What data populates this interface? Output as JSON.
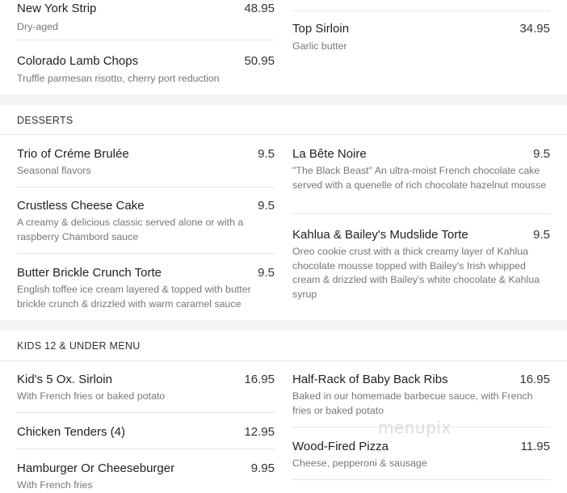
{
  "steaks": {
    "left": [
      {
        "name": "New York Strip",
        "price": "48.95",
        "desc": "Dry-aged"
      },
      {
        "name": "Colorado Lamb Chops",
        "price": "50.95",
        "desc": "Truffle parmesan risotto, cherry port reduction"
      }
    ],
    "right": [
      {
        "name": "Top Sirloin",
        "price": "34.95",
        "desc": "Garlic butter"
      }
    ]
  },
  "desserts": {
    "title": "DESSERTS",
    "left": [
      {
        "name": "Trio of Créme Brulée",
        "price": "9.5",
        "desc": "Seasonal flavors"
      },
      {
        "name": "Crustless Cheese Cake",
        "price": "9.5",
        "desc": "A creamy & delicious classic served alone or with a raspberry Chambord sauce"
      },
      {
        "name": "Butter Brickle Crunch Torte",
        "price": "9.5",
        "desc": "English toffee ice cream layered & topped with butter brickle crunch & drizzled with warm caramel sauce"
      }
    ],
    "right": [
      {
        "name": "La Bête Noire",
        "price": "9.5",
        "desc": "\"The Black Beast\" An ultra-moist French chocolate cake served with a quenelle of rich chocolate hazelnut mousse"
      },
      {
        "name": "Kahlua & Bailey's Mudslide Torte",
        "price": "9.5",
        "desc": "Oreo cookie crust with a thick creamy layer of Kahlua chocolate mousse topped with Bailey's Irish whipped cream & drizzled with Bailey's white chocolate & Kahlua syrup"
      }
    ]
  },
  "kids": {
    "title": "KIDS 12 & UNDER MENU",
    "left": [
      {
        "name": "Kid's 5 Ox. Sirloin",
        "price": "16.95",
        "desc": "With French fries or baked potato"
      },
      {
        "name": "Chicken Tenders (4)",
        "price": "12.95",
        "desc": ""
      },
      {
        "name": "Hamburger Or Cheeseburger",
        "price": "9.95",
        "desc": "With French fries"
      }
    ],
    "right": [
      {
        "name": "Half-Rack of Baby Back Ribs",
        "price": "16.95",
        "desc": "Baked in our homemade barbecue sauce, with French fries or baked potato"
      },
      {
        "name": "Wood-Fired Pizza",
        "price": "11.95",
        "desc": "Cheese, pepperoni & sausage"
      }
    ]
  },
  "watermark": "menupix"
}
